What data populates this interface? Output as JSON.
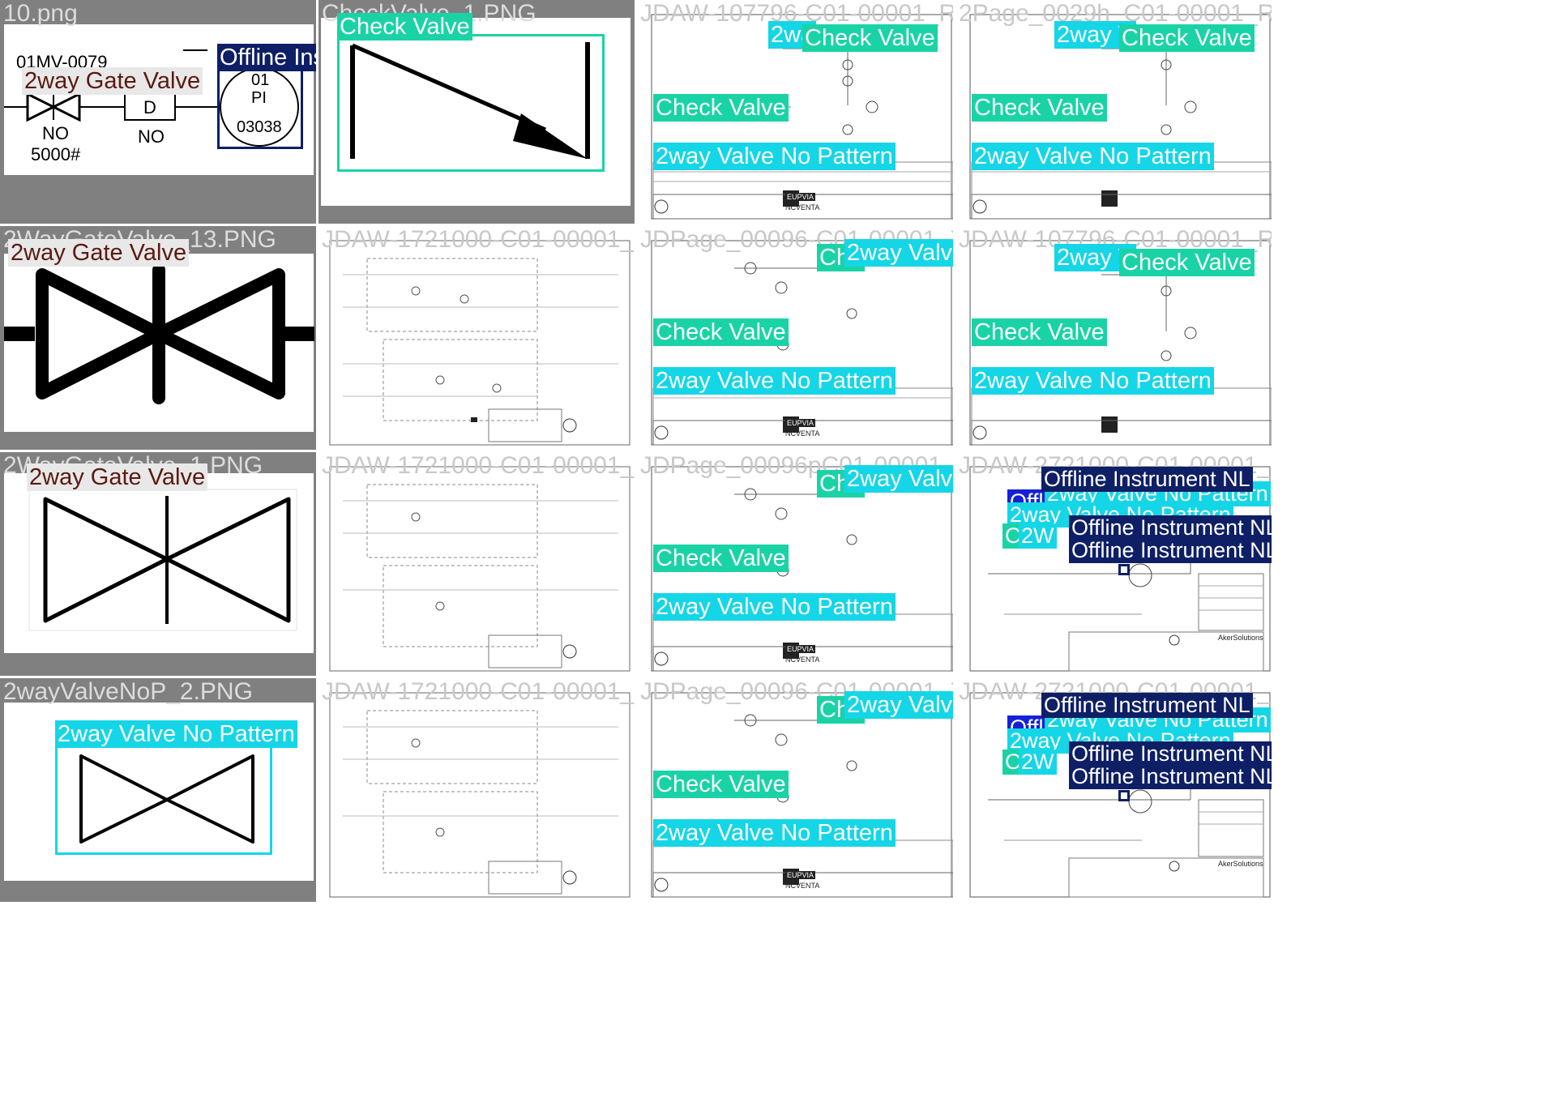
{
  "colors": {
    "gate_valve": "#5a1a10",
    "check_valve": "#19d3a6",
    "valve_no_pattern": "#14d6e6",
    "offline_instrument": "#0e1f66",
    "offline_instrument_bright": "#1521d8",
    "tile_background": "#808080",
    "drawing_background": "#ffffff"
  },
  "class_names": {
    "gate": "2way Gate Valve",
    "check": "Check Valve",
    "nopattern": "2way Valve No Pattern",
    "offline": "Offline Instrument NL",
    "truncated_offline": "Offli",
    "truncated_check": "Che",
    "truncated_c": "C",
    "truncated_2way": "2way V",
    "truncated_2wa": "2wa",
    "truncated_2w": "2W"
  },
  "tiles": {
    "r0c0": {
      "filename": "10.png",
      "tag_top": "01MV-0079",
      "no_left": "NO",
      "rating": "5000#",
      "d_box": "D",
      "no_right": "NO",
      "pi_line1": "01",
      "pi_line2": "PI",
      "pi_line3": "03038"
    },
    "r0c1": {
      "filename": "CheckValve_1.PNG"
    },
    "r0c2": {
      "filename": "JDAW-107796-C01-00001_R05"
    },
    "r0c3": {
      "filename": "2Page_0029h_C01-00001_R05"
    },
    "r1c0": {
      "filename": "2WayGateValve_13.PNG"
    },
    "r1c1": {
      "filename": "JDAW-1721000-C01-00001_Z01"
    },
    "r1c2": {
      "filename": "JDPage_00096-C01-00001_Z01"
    },
    "r1c3": {
      "filename": "JDAW-107796-C01-00001_R05"
    },
    "r2c0": {
      "filename": "2WayGateValve_1.PNG"
    },
    "r2c1": {
      "filename": "JDAW-1721000-C01-00001_Z01"
    },
    "r2c2": {
      "filename": "JDPage_00096pC01-00001_Z01"
    },
    "r2c3": {
      "filename": "JDAW-2721000-C01-00001_Z01"
    },
    "r3c0": {
      "filename": "2wayValveNoP_2.PNG"
    },
    "r3c1": {
      "filename": "JDAW-1721000-C01-00001_Z01"
    },
    "r3c2": {
      "filename": "JDPage_00096-C01-00001_Z01"
    },
    "r3c3": {
      "filename": "JDAW-2721000-C01-00001_Z01"
    }
  },
  "title_block": {
    "company_a": "EUPVIA",
    "company_b": "NCVENTA",
    "company_c": "AkerSolutions"
  }
}
